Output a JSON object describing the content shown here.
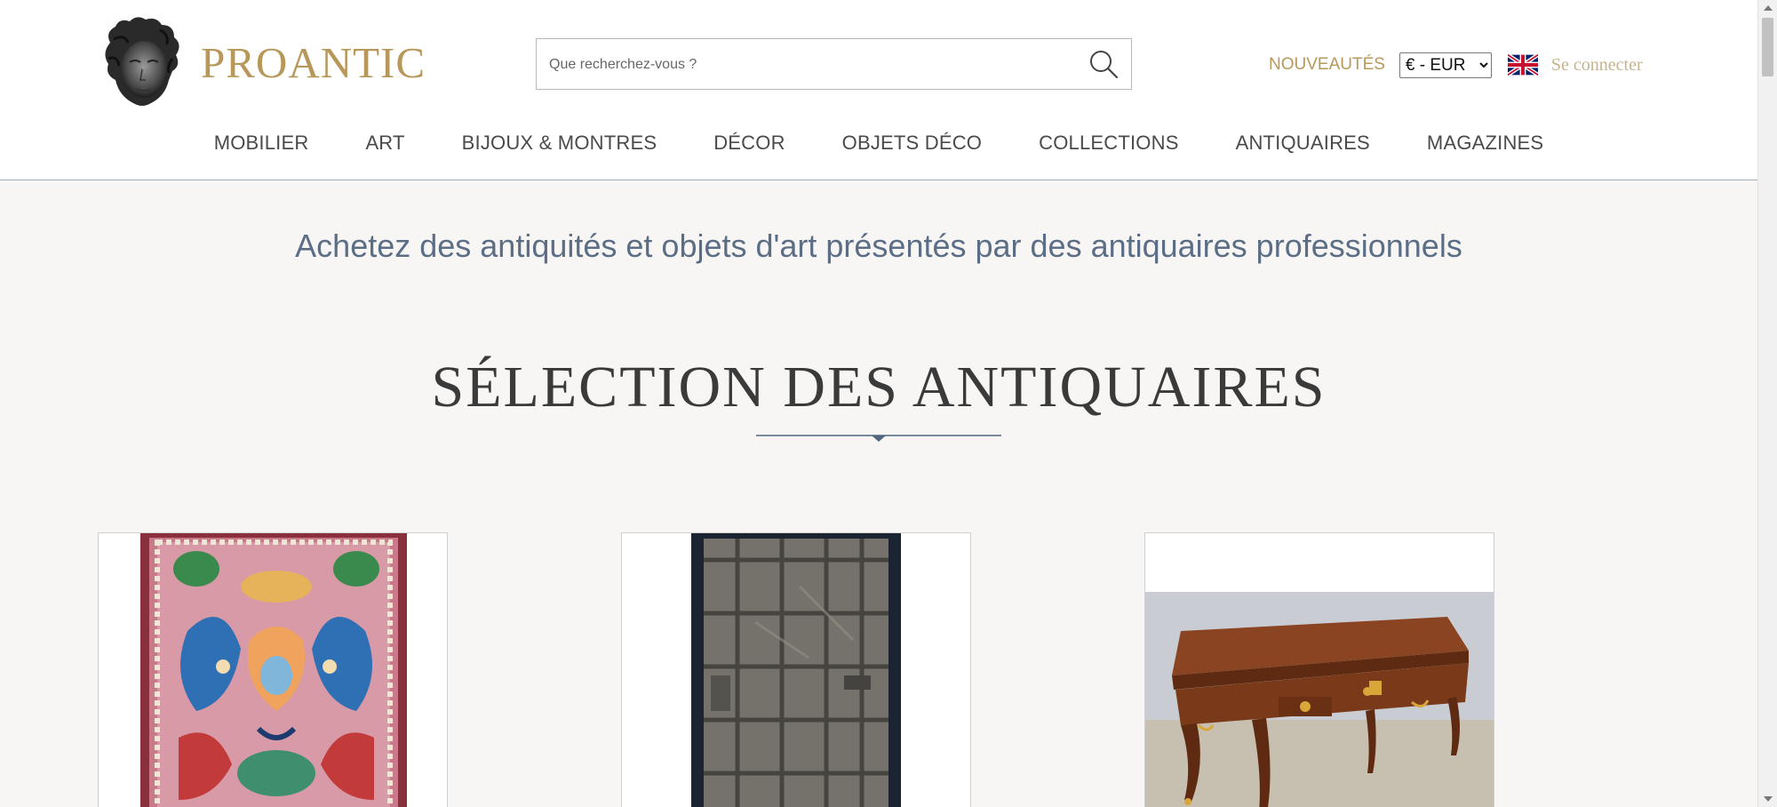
{
  "header": {
    "logo_text": "PROANTIC",
    "search": {
      "placeholder": "Que recherchez-vous ?",
      "value": ""
    },
    "new_items_label": "NOUVEAUTÉS",
    "currency": {
      "selected": "€ - EUR",
      "options": [
        "€ - EUR"
      ]
    },
    "language_flag": "uk-flag-icon",
    "login_label": "Se connecter"
  },
  "nav": {
    "items": [
      {
        "label": "MOBILIER"
      },
      {
        "label": "ART"
      },
      {
        "label": "BIJOUX & MONTRES"
      },
      {
        "label": "DÉCOR"
      },
      {
        "label": "OBJETS DÉCO"
      },
      {
        "label": "COLLECTIONS"
      },
      {
        "label": "ANTIQUAIRES"
      },
      {
        "label": "MAGAZINES"
      }
    ]
  },
  "main": {
    "tagline": "Achetez des antiquités et objets d'art présentés par des antiquaires professionnels",
    "section_title": "SÉLECTION DES ANTIQUAIRES",
    "cards": [
      {
        "image": "persian-rug"
      },
      {
        "image": "iron-door"
      },
      {
        "image": "wooden-desk"
      }
    ]
  },
  "colors": {
    "brand_gold": "#b8985a",
    "tagline_blue": "#5b6e86",
    "page_background": "#f7f6f4"
  }
}
